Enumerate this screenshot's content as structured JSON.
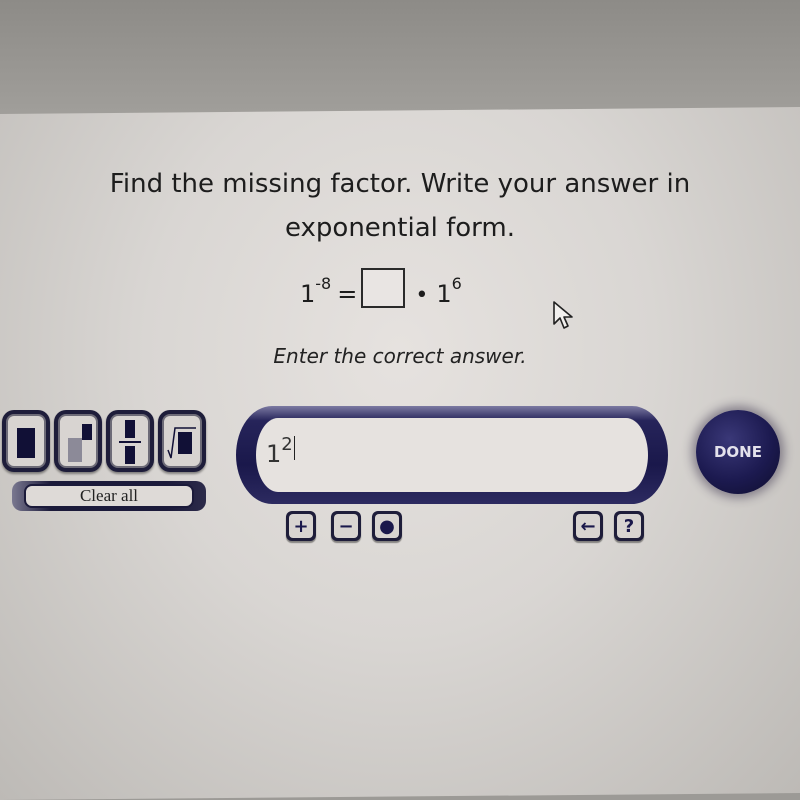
{
  "question": {
    "line1": "Find the missing factor. Write your answer in",
    "line2": "exponential form."
  },
  "equation": {
    "lhs_base": "1",
    "lhs_exponent": "-8",
    "equals": "=",
    "operator": "•",
    "rhs_base": "1",
    "rhs_exponent": "6"
  },
  "instruction": "Enter the correct answer.",
  "template_buttons": [
    {
      "name": "box-template"
    },
    {
      "name": "exponent-template"
    },
    {
      "name": "fraction-template"
    },
    {
      "name": "square-root-template"
    }
  ],
  "clear_all_label": "Clear all",
  "answer": {
    "base": "1",
    "exponent": "2"
  },
  "keys": {
    "plus": "+",
    "minus": "−",
    "dot": "●",
    "backspace": "←",
    "help": "?"
  },
  "done_label": "DONE",
  "colors": {
    "accent": "#1a184b",
    "button_face": "#d8d4d1"
  }
}
